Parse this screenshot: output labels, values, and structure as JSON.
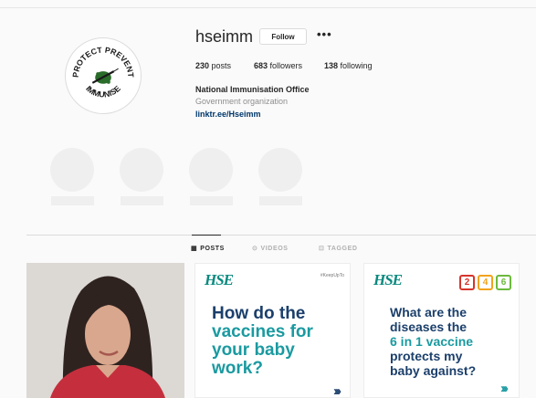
{
  "profile": {
    "username": "hseimm",
    "follow_label": "Follow",
    "more_label": "•••",
    "logo_text_top": "PROTECT PREVENT",
    "logo_text_bottom": "IMMUNISE",
    "stats": {
      "posts_count": "230",
      "posts_label": "posts",
      "followers_count": "683",
      "followers_label": "followers",
      "following_count": "138",
      "following_label": "following"
    },
    "full_name": "National Immunisation Office",
    "category": "Government organization",
    "link": "linktr.ee/Hseimm"
  },
  "tabs": [
    {
      "label": "POSTS",
      "icon": "grid-icon",
      "active": true
    },
    {
      "label": "VIDEOS",
      "icon": "video-icon",
      "active": false
    },
    {
      "label": "TAGGED",
      "icon": "tag-icon",
      "active": false
    }
  ],
  "posts": {
    "post2": {
      "logo": "HSE",
      "hashtag": "#KeepUpTo",
      "line1": "How do the",
      "line2": "vaccines for",
      "line3": "your baby",
      "line4": "work?",
      "arrow": "›››"
    },
    "post3": {
      "logo": "HSE",
      "month_2": "2",
      "month_4": "4",
      "month_6": "6",
      "line1": "What are the",
      "line2": "diseases the",
      "line3": "6 in 1 vaccine",
      "line4": "protects my",
      "line5": "baby against?",
      "arrow": "›››"
    }
  },
  "colors": {
    "link": "#00376b",
    "hse_teal": "#1a9aa0",
    "hse_navy": "#1b3f6b"
  }
}
